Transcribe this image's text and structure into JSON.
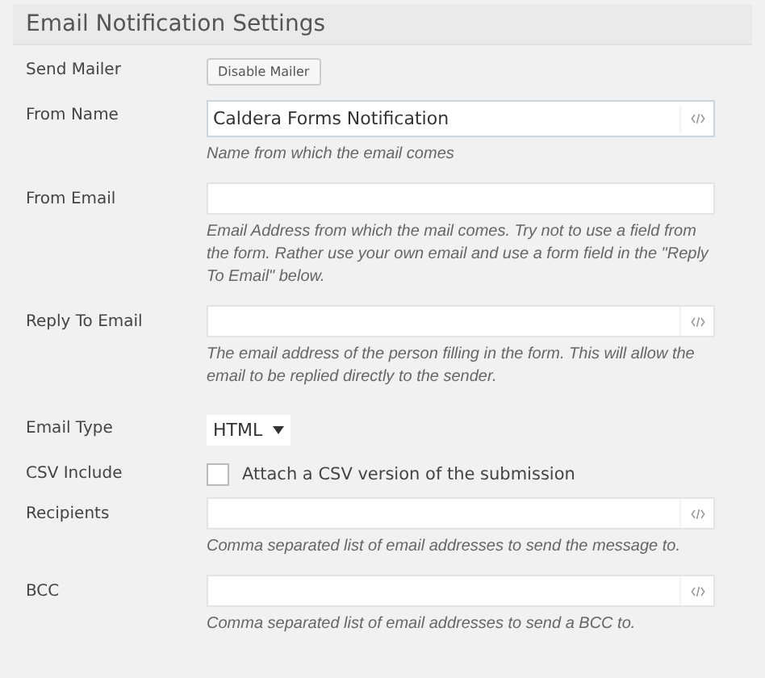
{
  "title": "Email Notification Settings",
  "rows": [
    {
      "kind": "button",
      "label": "Send Mailer",
      "button": "Disable Mailer"
    },
    {
      "kind": "text",
      "label": "From Name",
      "value": "Caldera Forms Notification",
      "magic_tag": true,
      "description": "Name from which the email comes"
    },
    {
      "kind": "text",
      "label": "From Email",
      "magic_tag": false,
      "description": "Email Address from which the mail comes. Try not to use a field from the form. Rather use your own email and use a form field in the \"Reply To Email\" below."
    },
    {
      "kind": "text",
      "label": "Reply To Email",
      "magic_tag": true,
      "description": "The email address of the person filling in the form. This will allow the email to be replied directly to the sender."
    },
    {
      "kind": "select",
      "label": "Email Type",
      "value": "HTML"
    },
    {
      "kind": "checkbox",
      "label": "CSV Include",
      "checked": false,
      "text": "Attach a CSV version of the submission"
    },
    {
      "kind": "text",
      "label": "Recipients",
      "magic_tag": true,
      "description": "Comma separated list of email addresses to send the message to."
    },
    {
      "kind": "text",
      "label": "BCC",
      "magic_tag": true,
      "description": "Comma separated list of email addresses to send a BCC to."
    }
  ]
}
